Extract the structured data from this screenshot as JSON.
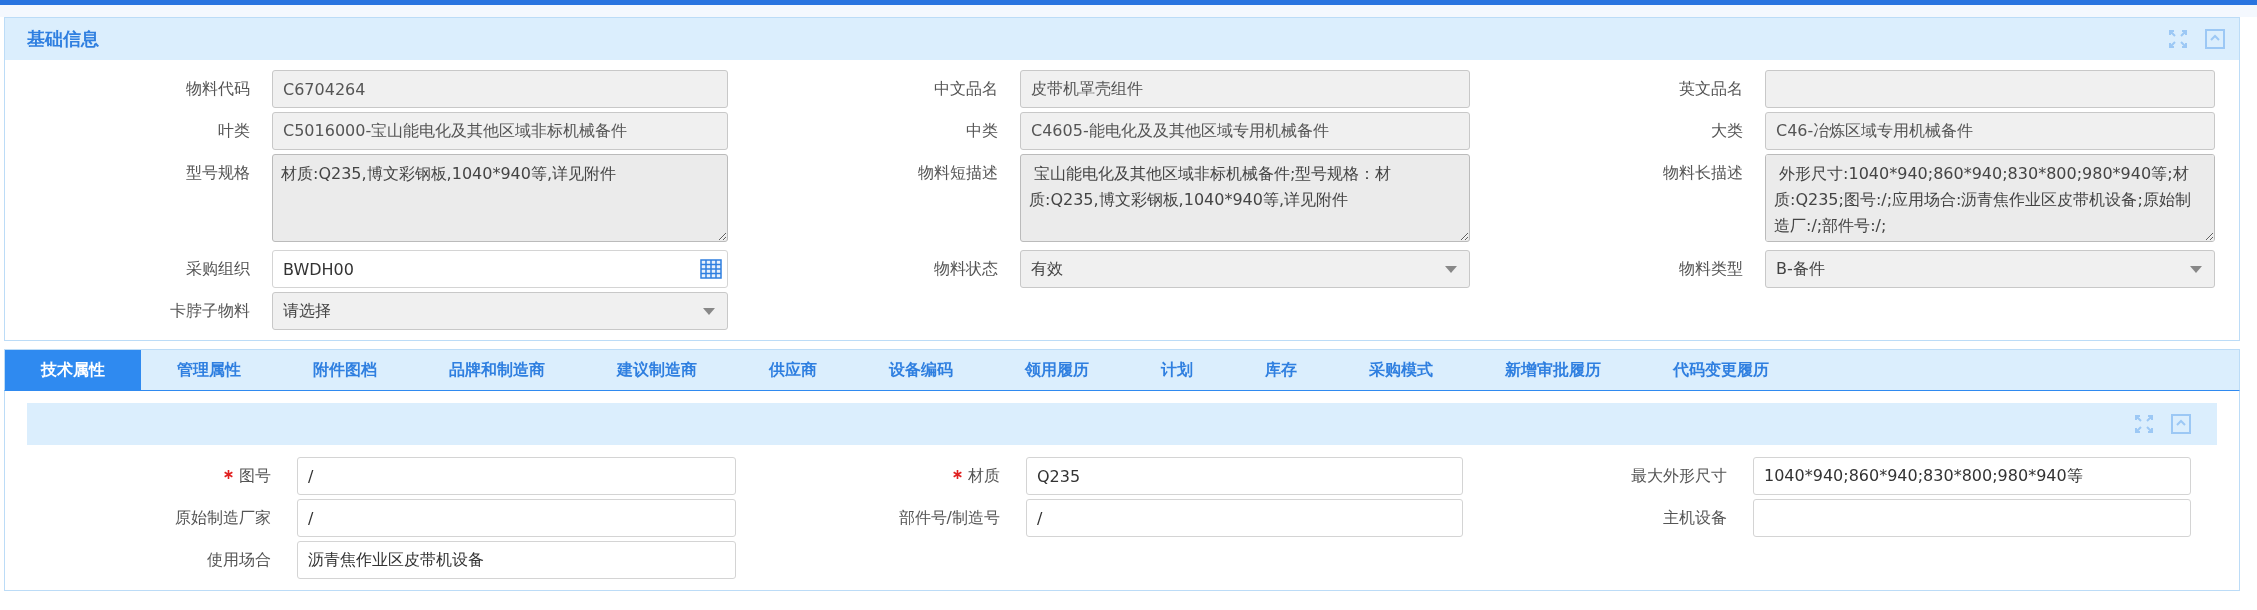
{
  "basic_panel": {
    "title": "基础信息",
    "rows": [
      [
        {
          "label": "物料代码",
          "kind": "text",
          "value": "C6704264",
          "disabled": true
        },
        {
          "label": "中文品名",
          "kind": "text",
          "value": "皮带机罩壳组件",
          "disabled": true
        },
        {
          "label": "英文品名",
          "kind": "text",
          "disabled": true
        }
      ],
      [
        {
          "label": "叶类",
          "kind": "text",
          "value": "C5016000-宝山能电化及其他区域非标机械备件",
          "disabled": true
        },
        {
          "label": "中类",
          "kind": "text",
          "value": "C4605-能电化及及其他区域专用机械备件",
          "disabled": true
        },
        {
          "label": "大类",
          "kind": "text",
          "value": "C46-冶炼区域专用机械备件",
          "disabled": true
        }
      ],
      [
        {
          "label": "型号规格",
          "kind": "textarea",
          "value": "材质:Q235,博文彩钢板,1040*940等,详见附件",
          "disabled": true
        },
        {
          "label": "物料短描述",
          "kind": "textarea",
          "value": " 宝山能电化及其他区域非标机械备件;型号规格：材质:Q235,博文彩钢板,1040*940等,详见附件",
          "disabled": true
        },
        {
          "label": "物料长描述",
          "kind": "textarea",
          "value": " 外形尺寸:1040*940;860*940;830*800;980*940等;材质:Q235;图号:/;应用场合:沥青焦作业区皮带机设备;原始制造厂:/;部件号:/;",
          "disabled": true
        }
      ],
      [
        {
          "label": "采购组织",
          "kind": "picker",
          "value": "BWDH00",
          "disabled": false
        },
        {
          "label": "物料状态",
          "kind": "select",
          "value": "有效",
          "disabled": true
        },
        {
          "label": "物料类型",
          "kind": "select",
          "value": "B-备件",
          "disabled": true
        }
      ],
      [
        {
          "label": "卡脖子物料",
          "kind": "select",
          "placeholder": "请选择",
          "disabled": true
        }
      ]
    ]
  },
  "tabs": [
    {
      "label": "技术属性",
      "selected": true
    },
    {
      "label": "管理属性",
      "selected": false
    },
    {
      "label": "附件图档",
      "selected": false
    },
    {
      "label": "品牌和制造商",
      "selected": false
    },
    {
      "label": "建议制造商",
      "selected": false
    },
    {
      "label": "供应商",
      "selected": false
    },
    {
      "label": "设备编码",
      "selected": false
    },
    {
      "label": "领用履历",
      "selected": false
    },
    {
      "label": "计划",
      "selected": false
    },
    {
      "label": "库存",
      "selected": false
    },
    {
      "label": "采购模式",
      "selected": false
    },
    {
      "label": "新增审批履历",
      "selected": false
    },
    {
      "label": "代码变更履历",
      "selected": false
    }
  ],
  "tech_panel": {
    "rows": [
      [
        {
          "label": "图号",
          "kind": "text",
          "value": "/",
          "required": true
        },
        {
          "label": "材质",
          "kind": "text",
          "value": "Q235",
          "required": true
        },
        {
          "label": "最大外形尺寸",
          "kind": "text",
          "value": "1040*940;860*940;830*800;980*940等",
          "required": false
        }
      ],
      [
        {
          "label": "原始制造厂家",
          "kind": "text",
          "value": "/",
          "required": false
        },
        {
          "label": "部件号/制造号",
          "kind": "text",
          "value": "/",
          "required": false
        },
        {
          "label": "主机设备",
          "kind": "text",
          "required": false
        }
      ],
      [
        {
          "label": "使用场合",
          "kind": "text",
          "value": "沥青焦作业区皮带机设备",
          "required": false
        }
      ]
    ]
  }
}
